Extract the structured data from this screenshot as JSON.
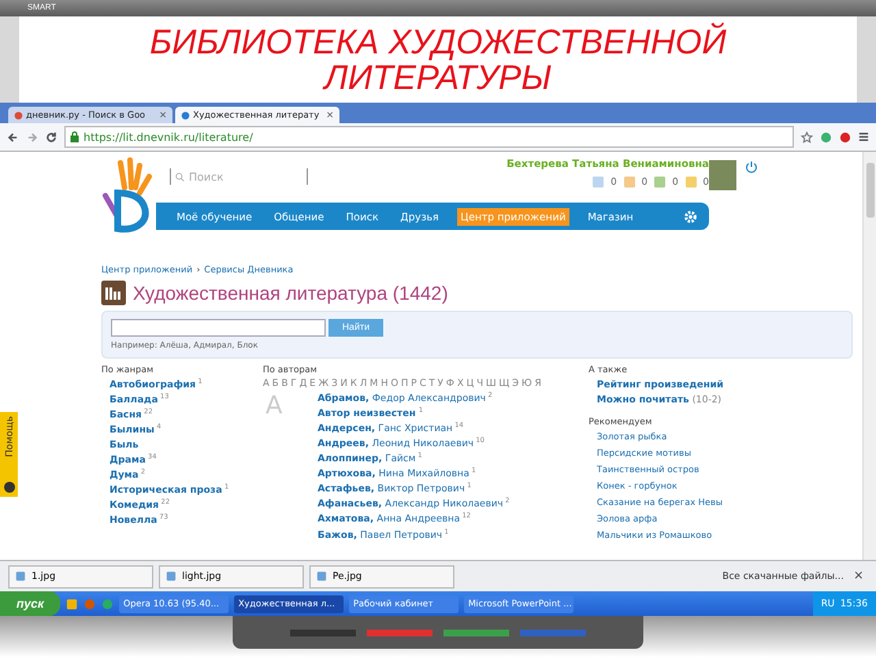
{
  "board": {
    "brand": "SMART"
  },
  "slide_title": "БИБЛИОТЕКА ХУДОЖЕСТВЕННОЙ ЛИТЕРАТУРЫ",
  "browser": {
    "tabs": [
      {
        "label": "дневник.ру - Поиск в Goo",
        "selected": false,
        "close": "×"
      },
      {
        "label": "Художественная литерату",
        "selected": true,
        "close": "×"
      }
    ],
    "address": "https://lit.dnevnik.ru/literature/"
  },
  "header": {
    "search": {
      "placeholder": "Поиск"
    },
    "user": "Бехтерева Татьяна Вениаминовна",
    "counters": [
      "0",
      "0",
      "0",
      "0"
    ]
  },
  "nav": [
    {
      "label": "Моё обучение",
      "selected": false
    },
    {
      "label": "Общение",
      "selected": false
    },
    {
      "label": "Поиск",
      "selected": false
    },
    {
      "label": "Друзья",
      "selected": false
    },
    {
      "label": "Центр приложений",
      "selected": true
    },
    {
      "label": "Магазин",
      "selected": false
    }
  ],
  "breadcrumb": {
    "items": [
      "Центр приложений",
      "Сервисы Дневника"
    ],
    "separator": "›"
  },
  "heading": "Художественная литература (1442)",
  "find": {
    "button": "Найти",
    "hint": "Например: Алёша, Адмирал, Блок"
  },
  "genres": {
    "title": "По жанрам",
    "items": [
      {
        "name": "Автобиография",
        "count": "1"
      },
      {
        "name": "Баллада",
        "count": "13"
      },
      {
        "name": "Басня",
        "count": "22"
      },
      {
        "name": "Былины",
        "count": "4"
      },
      {
        "name": "Быль"
      },
      {
        "name": "Драма",
        "count": "34"
      },
      {
        "name": "Дума",
        "count": "2"
      },
      {
        "name": "Историческая проза",
        "count": "1"
      },
      {
        "name": "Комедия",
        "count": "22"
      },
      {
        "name": "Новелла",
        "count": "73"
      }
    ]
  },
  "authors": {
    "title": "По авторам",
    "letters": [
      "А",
      "Б",
      "В",
      "Г",
      "Д",
      "Е",
      "Ж",
      "З",
      "И",
      "К",
      "Л",
      "М",
      "Н",
      "О",
      "П",
      "Р",
      "С",
      "Т",
      "У",
      "Ф",
      "Х",
      "Ц",
      "Ч",
      "Ш",
      "Щ",
      "Э",
      "Ю",
      "Я"
    ],
    "groups": [
      {
        "letter": "А",
        "items": [
          {
            "surname": "Абрамов,",
            "name": "Федор Александрович",
            "count": "2"
          },
          {
            "surname": "Автор неизвестен",
            "count": "1"
          },
          {
            "surname": "Андерсен,",
            "name": "Ганс Христиан",
            "count": "14"
          },
          {
            "surname": "Андреев,",
            "name": "Леонид Николаевич",
            "count": "10"
          },
          {
            "surname": "Алоппинер,",
            "name": "Гайсм",
            "count": "1"
          },
          {
            "surname": "Артюхова,",
            "name": "Нина Михайловна",
            "count": "1"
          },
          {
            "surname": "Астафьев,",
            "name": "Виктор Петрович",
            "count": "1"
          },
          {
            "surname": "Афанасьев,",
            "name": "Александр Николаевич",
            "count": "2"
          },
          {
            "surname": "Ахматова,",
            "name": "Анна Андреевна",
            "count": "12"
          }
        ]
      },
      {
        "items": [
          {
            "surname": "Бажов,",
            "name": "Павел Петрович",
            "count": "1"
          }
        ]
      }
    ]
  },
  "also": {
    "title": "А также",
    "links": [
      {
        "label": "Рейтинг произведений"
      },
      {
        "label": "Можно почитать",
        "note": "(10-2)"
      }
    ],
    "rec_title": "Рекомендуем",
    "recommended": [
      "Золотая рыбка",
      "Персидские мотивы",
      "Таинственный остров",
      "Конек - горбунок",
      "Сказание на берегах Невы",
      "Эолова арфа",
      "Мальчики из Ромашково"
    ]
  },
  "help_tab": "Помощь",
  "downloads": {
    "files": [
      "1.jpg",
      "light.jpg",
      "Pe.jpg"
    ],
    "all": "Все скачанные файлы...",
    "close": "×"
  },
  "taskbar": {
    "start": "пуск",
    "tasks": [
      {
        "label": "Opera 10.63 (95.40...",
        "selected": false
      },
      {
        "label": "Художественная л...",
        "selected": true
      },
      {
        "label": "Рабочий кабинет",
        "selected": false
      },
      {
        "label": "Microsoft PowerPoint ...",
        "selected": false
      }
    ],
    "lang": "RU",
    "time": "15:36"
  }
}
